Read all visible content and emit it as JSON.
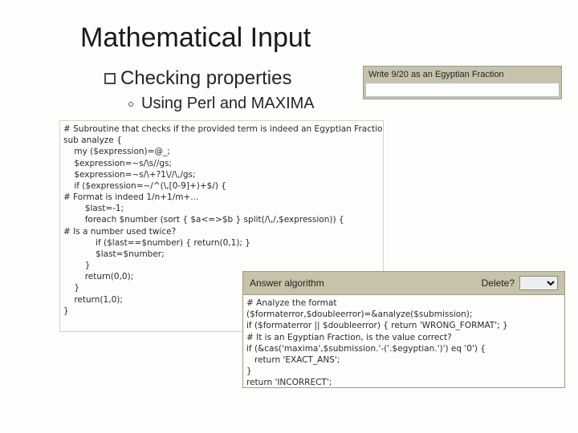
{
  "title": "Mathematical Input",
  "subtitle": "Checking properties",
  "subline": "Using Perl and MAXIMA",
  "question_label": "Write 9/20 as an Egyptian Fraction",
  "answer_algo_label": "Answer algorithm",
  "delete_label": "Delete?",
  "code1": "# Subroutine that checks if the provided term is indeed an Egyptian Fraction\nsub analyze {\n    my ($expression)=@_;\n    $expression=~s/\\s//gs;\n    $expression=~s/\\+?1\\//\\,/gs;\n    if ($expression=~/^(\\,[0-9]+)+$/) {\n# Format is indeed 1/n+1/m+...\n        $last=-1;\n        foreach $number (sort { $a<=>$b } split(/\\,/,$expression)) {\n# Is a number used twice?\n            if ($last==$number) { return(0,1); }\n            $last=$number;\n        }\n        return(0,0);\n    }\n    return(1,0);\n}",
  "code2": "# Analyze the format\n($formaterror,$doubleerror)=&analyze($submission);\nif ($formaterror || $doubleerror) { return 'WRONG_FORMAT'; }\n# It is an Egyptian Fraction, is the value correct?\nif (&cas('maxima',$submission.'-('.$egyptian.')') eq '0') {\n   return 'EXACT_ANS';\n}\nreturn 'INCORRECT';"
}
